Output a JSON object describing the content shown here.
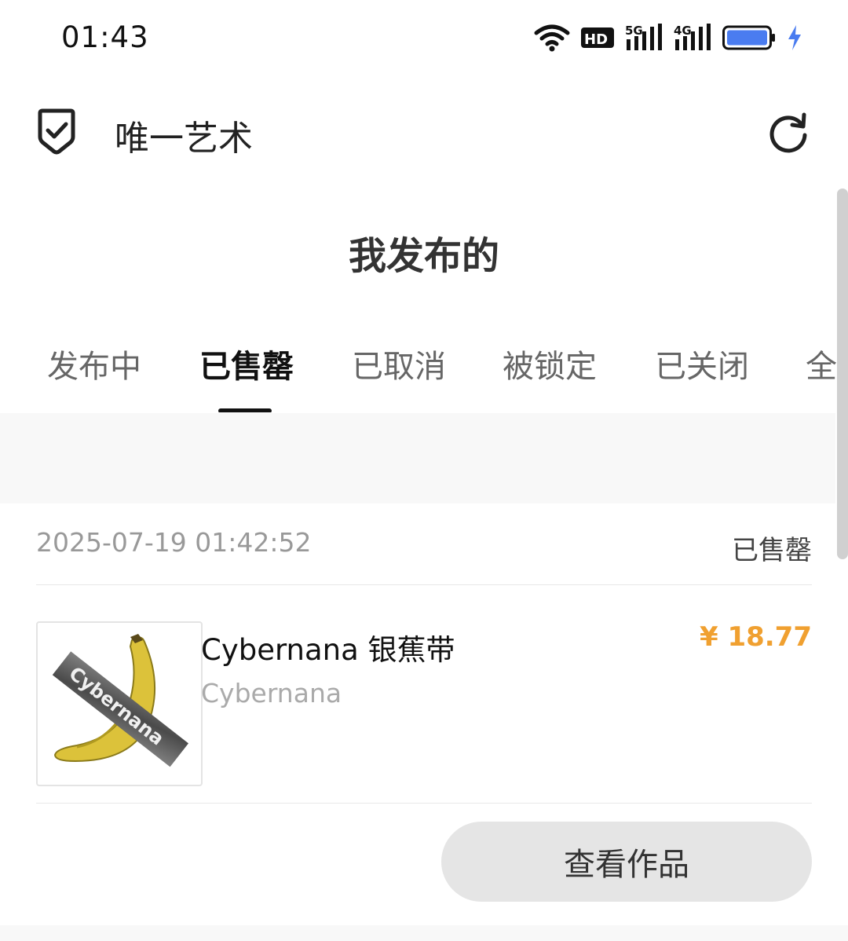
{
  "status_bar": {
    "time": "01:43",
    "icons": [
      "wifi-icon",
      "hd-icon",
      "5g-signal-icon",
      "4g-signal-icon",
      "battery-icon",
      "charging-icon"
    ],
    "hd_label": "HD",
    "net1_label": "5G",
    "net2_label": "4G",
    "battery_color": "#4a7cf0"
  },
  "header": {
    "app_title": "唯一艺术",
    "logo_icon": "shield-check-icon",
    "refresh_icon": "refresh-icon"
  },
  "page": {
    "title": "我发布的"
  },
  "tabs": [
    {
      "label": "发布中",
      "active": false
    },
    {
      "label": "已售罄",
      "active": true
    },
    {
      "label": "已取消",
      "active": false
    },
    {
      "label": "被锁定",
      "active": false
    },
    {
      "label": "已关闭",
      "active": false
    },
    {
      "label": "全部",
      "active": false
    }
  ],
  "order": {
    "time": "2025-07-19 01:42:52",
    "status": "已售罄",
    "product_name": "Cybernana 银蕉带",
    "artist": "Cybernana",
    "price": "¥ 18.77",
    "thumb_tape_text": "Cybernana",
    "view_button": "查看作品"
  },
  "colors": {
    "price": "#f0a030",
    "button_bg": "#e5e5e5",
    "active_tab": "#111111"
  }
}
